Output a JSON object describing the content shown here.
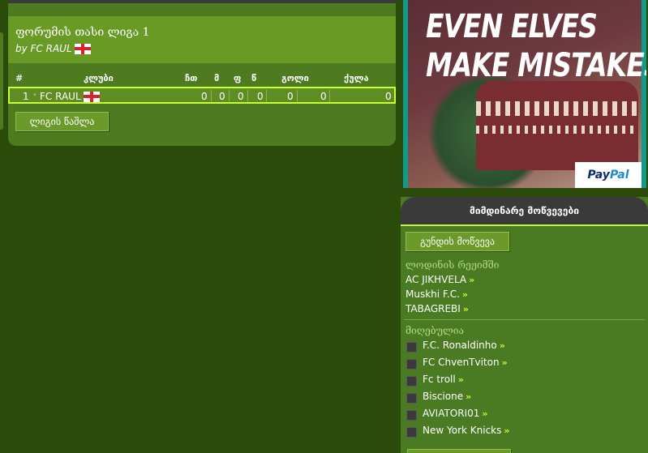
{
  "league": {
    "title": "ფორუმის თასი ლიგა 1",
    "by": "by FC RAUL",
    "columns": {
      "rank": "#",
      "club": "კლუბი",
      "played": "ჩთ",
      "wins": "მ",
      "draws": "ფ",
      "losses": "წ",
      "goals": "გოლი",
      "points": "ქულა"
    },
    "rows": [
      {
        "rank": "1",
        "club": "FC RAUL",
        "played": "0",
        "wins": "0",
        "draws": "0",
        "losses": "0",
        "goals_for": "0",
        "goals_against": "0",
        "points": "0"
      }
    ],
    "delete_button": "ლიგის წაშლა"
  },
  "ad": {
    "line1": "EVEN ELVES",
    "line2": "MAKE MISTAKES.",
    "brand_part1": "Pay",
    "brand_part2": "Pal",
    "colors": {
      "stripe": "#0f9a8a",
      "paypal_dark": "#0e2c6c",
      "paypal_light": "#1f8ad8"
    }
  },
  "matches_panel": {
    "title": "მიმდინარე მოწვევები",
    "team_invite_button": "გუნდის მოწვევა",
    "pending_label": "ლოდინის რეჟიმში",
    "pending": [
      "AC JIKHVELA",
      "Muskhi F.C.",
      "TABAGREBI"
    ],
    "received_label": "მიღებულია",
    "received": [
      "F.C. Ronaldinho",
      "FC ChvenTviton",
      "Fc troll",
      "Biscione",
      "AVIATORI01",
      "New York Knicks"
    ],
    "arrow": "»"
  },
  "colors": {
    "accent": "#ccff33",
    "bg": "#2a4b0a",
    "panel": "#4e7b1f",
    "header": "#6a9a26"
  }
}
